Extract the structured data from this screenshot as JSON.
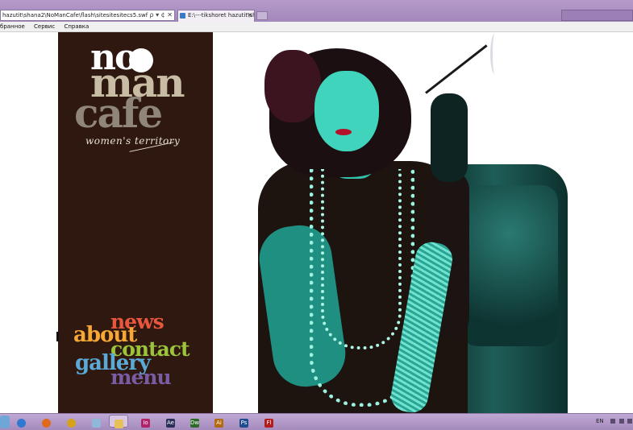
{
  "browser": {
    "address": "hazutit\\shana2\\NoManCafe\\flash\\sitesitesitecs5.swf",
    "address_icons": "ρ ▾ ¢ ✕",
    "tab_title": "E:\\---tikshoret hazutit\\shan...",
    "tab_close": "✕",
    "menu": [
      "бранное",
      "Сервис",
      "Справка"
    ]
  },
  "logo": {
    "line1": "no",
    "line2": "man",
    "line3": "cafe",
    "tagline": "women's territory",
    "colors": {
      "no": "#ffffff",
      "man": "#c8bca4",
      "cafe": "#8f8578"
    }
  },
  "nav": {
    "news": "news",
    "about": "about",
    "contact": "contact",
    "gallery": "gallery",
    "menu": "menu",
    "colors": {
      "news": "#e8573d",
      "about": "#f7a733",
      "contact": "#9cc43b",
      "gallery": "#5aa9d6",
      "menu": "#7a5ca4"
    }
  },
  "photo": {
    "icon": "woman-portrait-image"
  },
  "taskbar": {
    "apps": [
      {
        "name": "start-orb-icon",
        "label": ""
      },
      {
        "name": "ie-icon",
        "label": ""
      },
      {
        "name": "firefox-icon",
        "label": ""
      },
      {
        "name": "app-icon",
        "label": ""
      },
      {
        "name": "folder-icon",
        "label": ""
      },
      {
        "name": "explorer-icon",
        "label": ""
      },
      {
        "name": "indesign-icon",
        "label": "Io"
      },
      {
        "name": "aftereffects-icon",
        "label": "Ae"
      },
      {
        "name": "dreamweaver-icon",
        "label": "Dw"
      },
      {
        "name": "illustrator-icon",
        "label": "Ai"
      },
      {
        "name": "photoshop-icon",
        "label": "Ps"
      },
      {
        "name": "flash-icon",
        "label": "Fl"
      }
    ],
    "language": "EN"
  }
}
